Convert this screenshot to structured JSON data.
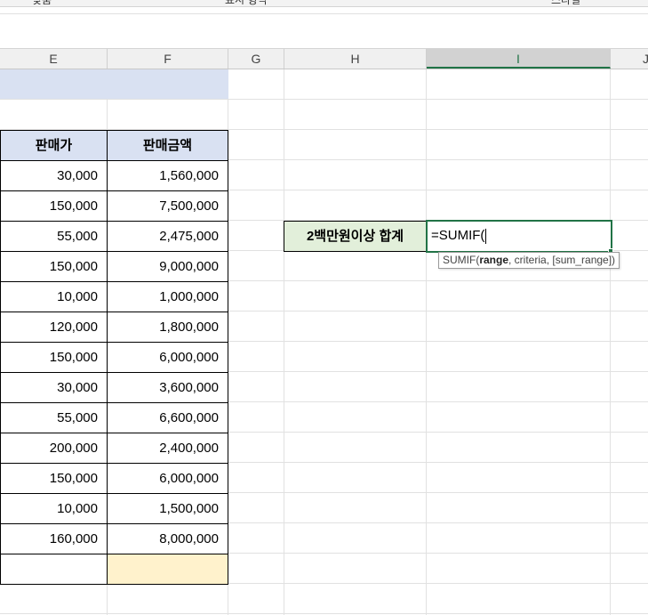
{
  "ribbon": {
    "labels": [
      "맞춤",
      "표시 형식",
      "스타일"
    ]
  },
  "columns": [
    {
      "letter": "E",
      "selected": false
    },
    {
      "letter": "F",
      "selected": false
    },
    {
      "letter": "G",
      "selected": false
    },
    {
      "letter": "H",
      "selected": false
    },
    {
      "letter": "I",
      "selected": true
    },
    {
      "letter": "J",
      "selected": false
    }
  ],
  "table": {
    "headers": [
      "판매가",
      "판매금액"
    ],
    "rows": [
      [
        "30,000",
        "1,560,000"
      ],
      [
        "150,000",
        "7,500,000"
      ],
      [
        "55,000",
        "2,475,000"
      ],
      [
        "150,000",
        "9,000,000"
      ],
      [
        "10,000",
        "1,000,000"
      ],
      [
        "120,000",
        "1,800,000"
      ],
      [
        "150,000",
        "6,000,000"
      ],
      [
        "30,000",
        "3,600,000"
      ],
      [
        "55,000",
        "6,600,000"
      ],
      [
        "200,000",
        "2,400,000"
      ],
      [
        "150,000",
        "6,000,000"
      ],
      [
        "10,000",
        "1,500,000"
      ],
      [
        "160,000",
        "8,000,000"
      ]
    ],
    "total_row": [
      "",
      ""
    ]
  },
  "summary": {
    "label": "2백만원이상 합계",
    "formula": "=SUMIF("
  },
  "tooltip": {
    "fn": "SUMIF(",
    "arg1": "range",
    "rest": ", criteria, [sum_range])"
  },
  "colors": {
    "header_fill": "#d9e1f2",
    "label_fill": "#e2efda",
    "total_fill": "#fff2cc",
    "accent": "#217346"
  }
}
